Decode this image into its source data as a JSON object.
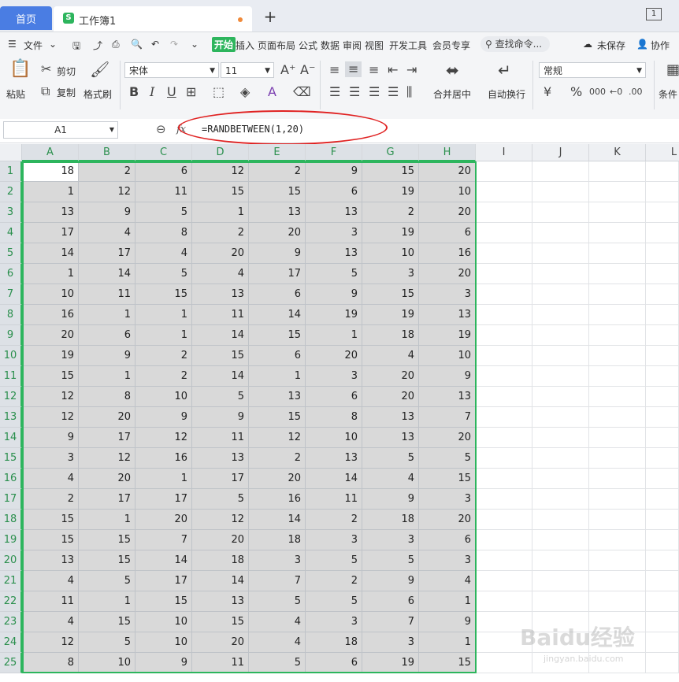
{
  "tabs": {
    "home": "首页",
    "doc": "工作簿1",
    "add": "+",
    "window_count": "1"
  },
  "menu": {
    "file": "文件",
    "items": [
      "开始",
      "插入",
      "页面布局",
      "公式",
      "数据",
      "审阅",
      "视图",
      "开发工具",
      "会员专享"
    ],
    "search": "查找命令...",
    "unsaved": "未保存",
    "collab": "协作"
  },
  "ribbon": {
    "paste": "粘贴",
    "cut": "剪切",
    "copy": "复制",
    "format_painter": "格式刷",
    "font_name": "宋体",
    "font_size": "11",
    "merge": "合并居中",
    "wrap": "自动换行",
    "number_format": "常规",
    "conditional": "条件"
  },
  "formula_bar": {
    "name_box": "A1",
    "fx": "fx",
    "formula": "=RANDBETWEEN(1,20)"
  },
  "columns": [
    "A",
    "B",
    "C",
    "D",
    "E",
    "F",
    "G",
    "H",
    "I",
    "J",
    "K",
    "L"
  ],
  "rows": [
    [
      18,
      2,
      6,
      12,
      2,
      9,
      15,
      20
    ],
    [
      1,
      12,
      11,
      15,
      15,
      6,
      19,
      10
    ],
    [
      13,
      9,
      5,
      1,
      13,
      13,
      2,
      20
    ],
    [
      17,
      4,
      8,
      2,
      20,
      3,
      19,
      6
    ],
    [
      14,
      17,
      4,
      20,
      9,
      13,
      10,
      16
    ],
    [
      1,
      14,
      5,
      4,
      17,
      5,
      3,
      20
    ],
    [
      10,
      11,
      15,
      13,
      6,
      9,
      15,
      3
    ],
    [
      16,
      1,
      1,
      11,
      14,
      19,
      19,
      13
    ],
    [
      20,
      6,
      1,
      14,
      15,
      1,
      18,
      19
    ],
    [
      19,
      9,
      2,
      15,
      6,
      20,
      4,
      10
    ],
    [
      15,
      1,
      2,
      14,
      1,
      3,
      20,
      9
    ],
    [
      12,
      8,
      10,
      5,
      13,
      6,
      20,
      13
    ],
    [
      12,
      20,
      9,
      9,
      15,
      8,
      13,
      7
    ],
    [
      9,
      17,
      12,
      11,
      12,
      10,
      13,
      20
    ],
    [
      3,
      12,
      16,
      13,
      2,
      13,
      5,
      5
    ],
    [
      4,
      20,
      1,
      17,
      20,
      14,
      4,
      15
    ],
    [
      2,
      17,
      17,
      5,
      16,
      11,
      9,
      3
    ],
    [
      15,
      1,
      20,
      12,
      14,
      2,
      18,
      20
    ],
    [
      15,
      15,
      7,
      20,
      18,
      3,
      3,
      6
    ],
    [
      13,
      15,
      14,
      18,
      3,
      5,
      5,
      3
    ],
    [
      4,
      5,
      17,
      14,
      7,
      2,
      9,
      4
    ],
    [
      11,
      1,
      15,
      13,
      5,
      5,
      6,
      1
    ],
    [
      4,
      15,
      10,
      15,
      4,
      3,
      7,
      9
    ],
    [
      12,
      5,
      10,
      20,
      4,
      18,
      3,
      1
    ],
    [
      8,
      10,
      9,
      11,
      5,
      6,
      19,
      15
    ]
  ],
  "watermark": {
    "main": "Baidu经验",
    "sub": "jingyan.baidu.com"
  }
}
